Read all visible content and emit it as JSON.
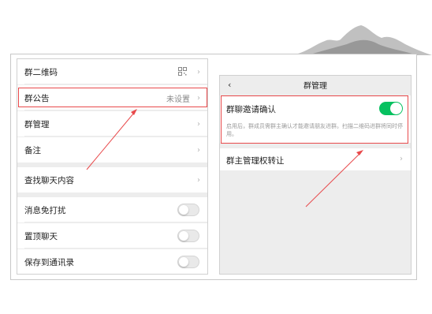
{
  "left_panel": {
    "rows": [
      {
        "label": "群二维码",
        "value": "",
        "type": "qr"
      },
      {
        "label": "群公告",
        "value": "未设置",
        "type": "chevron"
      },
      {
        "label": "群管理",
        "value": "",
        "type": "chevron"
      },
      {
        "label": "备注",
        "value": "",
        "type": "chevron"
      },
      {
        "label": "查找聊天内容",
        "value": "",
        "type": "chevron"
      },
      {
        "label": "消息免打扰",
        "value": "",
        "type": "toggle"
      },
      {
        "label": "置顶聊天",
        "value": "",
        "type": "toggle"
      },
      {
        "label": "保存到通讯录",
        "value": "",
        "type": "toggle"
      }
    ]
  },
  "right_panel": {
    "title": "群管理",
    "back_glyph": "‹",
    "invite": {
      "label": "群聊邀请确认",
      "description": "启用后，群成员需群主确认才能邀请朋友进群。扫描二维码进群将同时停用。",
      "enabled": true
    },
    "transfer_label": "群主管理权转让"
  },
  "glyphs": {
    "chevron": "›"
  },
  "colors": {
    "highlight": "#e8494b",
    "toggle_on": "#07c160"
  }
}
